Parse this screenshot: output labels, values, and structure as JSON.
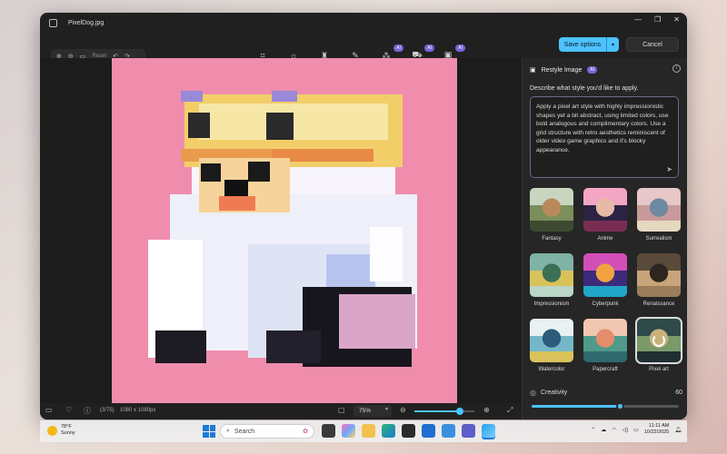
{
  "window": {
    "title": "PixelDog.jpg",
    "controls": [
      "—",
      "❐",
      "✕"
    ]
  },
  "toolbar": {
    "reset_label": "Reset",
    "save_label": "Save options",
    "cancel_label": "Cancel",
    "ai_badge": "AI",
    "tools": [
      "crop-icon",
      "adjust-icon",
      "filter-icon",
      "markup-icon",
      "erase-icon",
      "background-icon",
      "restyle-icon"
    ]
  },
  "panel": {
    "title": "Restyle Image",
    "ai_badge": "AI",
    "prompt_label": "Describe what style you'd like to apply.",
    "prompt_text": "Apply a pixel art style with highly impressionistic shapes yet a bit abstract, using limited colors, use bold analogous and complimentary colors. Use a grid structure with retro aesthetics reminiscent of older video game graphics and it's blocky appearance.",
    "styles": [
      {
        "label": "Fantasy",
        "colors": [
          "#c8d6c0",
          "#7b8f5b",
          "#b88a5b",
          "#3d4a30"
        ]
      },
      {
        "label": "Anime",
        "colors": [
          "#f3a6c4",
          "#2b2244",
          "#e6b9a7",
          "#7a2d52"
        ]
      },
      {
        "label": "Surrealism",
        "colors": [
          "#e7c7c7",
          "#c99a9a",
          "#6d8aa0",
          "#e6d9c0"
        ]
      },
      {
        "label": "Impressionism",
        "colors": [
          "#7fb3a6",
          "#d8c25a",
          "#3c6f53",
          "#b9d6c6"
        ]
      },
      {
        "label": "Cyberpunk",
        "colors": [
          "#d24fb8",
          "#3b2b7a",
          "#f0a340",
          "#21a6c9"
        ]
      },
      {
        "label": "Renaissance",
        "colors": [
          "#5a4a3a",
          "#c8a47a",
          "#2d2620",
          "#9a7d5b"
        ]
      },
      {
        "label": "Watercolor",
        "colors": [
          "#e9f1f3",
          "#74b7c9",
          "#2d5b7a",
          "#d9c25a"
        ]
      },
      {
        "label": "Papercraft",
        "colors": [
          "#f1c7b1",
          "#4f9a8a",
          "#e48c6b",
          "#2e6a6e"
        ]
      },
      {
        "label": "Pixel art",
        "colors": [
          "#2f4a4a",
          "#7a9a6a",
          "#c9b27a",
          "#1f2e30"
        ]
      }
    ],
    "selected_style": "Pixel art",
    "creativity_label": "Creativity",
    "creativity_value": "60",
    "creativity_level": 0.6
  },
  "statusbar": {
    "page": "(3/75)",
    "dimensions": "1080 x 1080px",
    "zoom": "75%",
    "zoom_level": 0.75
  },
  "taskbar": {
    "temperature": "78°F",
    "weather": "Sunny",
    "search_placeholder": "Search",
    "time": "11:11 AM",
    "date": "10/22/2025"
  }
}
